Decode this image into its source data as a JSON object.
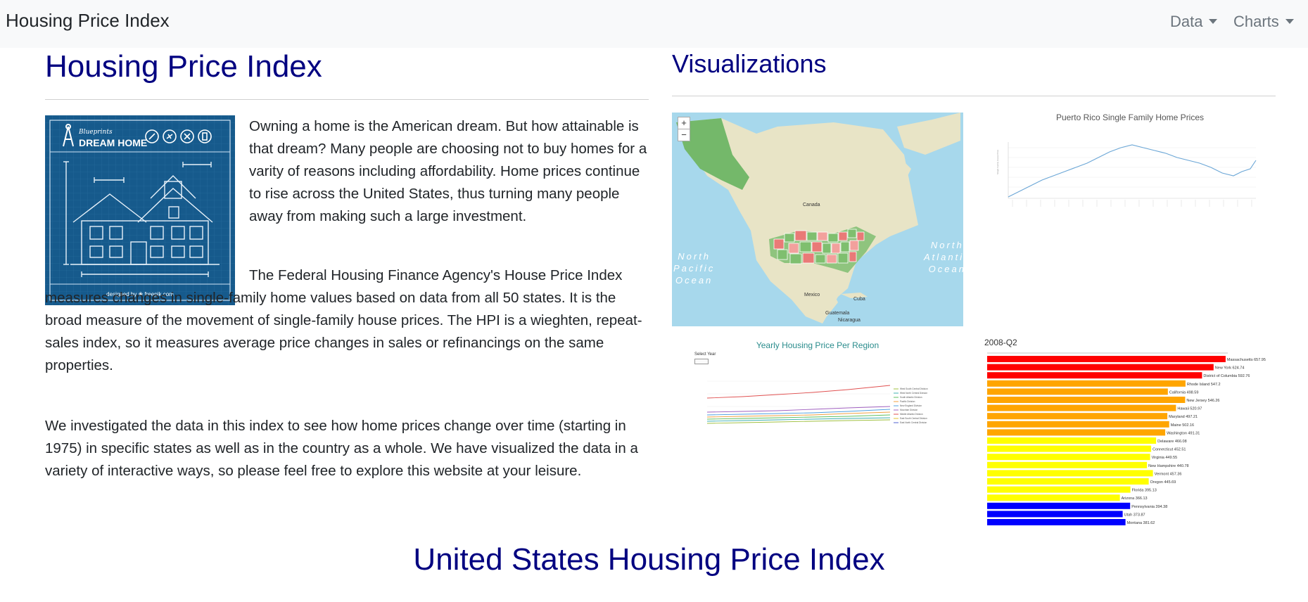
{
  "nav": {
    "brand": "Housing Price Index",
    "items": [
      {
        "label": "Data"
      },
      {
        "label": "Charts"
      }
    ]
  },
  "intro": {
    "title": "Housing Price Index",
    "image": {
      "logo_top": "Blueprints",
      "logo_text": "DREAM HOME",
      "credit": "designed by ❀ freepik.com"
    },
    "paragraphs": [
      "Owning a home is the American dream. But how attainable is that dream? Many people are choosing not to buy homes for a varity of reasons including affordability. Home prices continue to rise across the United States, thus turning many people away from making such a large investment.",
      "The Federal Housing Finance Agency's House Price Index measures changes in single-family home values based on data from all 50 states. It is the broad measure of the movement of single-family house prices. The HPI is a wieghten, repeat-sales index, so it measures average price changes in sales or refinancings on the same properties.",
      "We investigated the data in this index to see how home prices change over time (starting in 1975) in specific states as well as in the country as a whole. We have visualized the data in a variety of interactive ways, so please feel free to explore this website at your leisure."
    ]
  },
  "visualizations": {
    "title": "Visualizations",
    "map": {
      "zoom_in": "+",
      "zoom_out": "−",
      "labels": {
        "canada": "Canada",
        "mexico": "Mexico",
        "cuba": "Cuba",
        "guatemala": "Guatemala",
        "nicaragua": "Nicaragua"
      },
      "oceans": {
        "pacific": "North\nPacific\nOcean",
        "atlantic": "North\nAtlantic\nOcean"
      }
    },
    "line_chart_title": "Puerto Rico Single Family Home Prices",
    "region_chart_title": "Yearly Housing Price Per Region",
    "region_select_label": "Select Year",
    "region_legend": [
      "West South Central Division",
      "West North Central Division",
      "South Atlantic Division",
      "Pacific Division",
      "New England Division",
      "Mountain Division",
      "Middle Atlantic Division",
      "East South Central Division",
      "East North Central Division"
    ],
    "bar_chart_year": "2008-Q2",
    "bar_chart": [
      {
        "label": "Massachusetts 657.95",
        "value": 657.95,
        "color": "#ff0000"
      },
      {
        "label": "New York 624.74",
        "value": 624.74,
        "color": "#ff0000"
      },
      {
        "label": "District of Columbia 592.76",
        "value": 592.76,
        "color": "#ff0000"
      },
      {
        "label": "Rhode Island 547.2",
        "value": 547.2,
        "color": "#ffa500"
      },
      {
        "label": "California 498.59",
        "value": 498.59,
        "color": "#ffa500"
      },
      {
        "label": "New Jersey 546.26",
        "value": 546.26,
        "color": "#ffa500"
      },
      {
        "label": "Hawaii 520.97",
        "value": 520.97,
        "color": "#ffa500"
      },
      {
        "label": "Maryland 497.21",
        "value": 497.21,
        "color": "#ffa500"
      },
      {
        "label": "Maine 502.16",
        "value": 502.16,
        "color": "#ffa500"
      },
      {
        "label": "Washington 491.31",
        "value": 491.31,
        "color": "#ffa500"
      },
      {
        "label": "Delaware 466.08",
        "value": 466.08,
        "color": "#ffff00"
      },
      {
        "label": "Connecticut 452.51",
        "value": 452.51,
        "color": "#ffff00"
      },
      {
        "label": "Virginia 449.55",
        "value": 449.55,
        "color": "#ffff00"
      },
      {
        "label": "New Hampshire 440.78",
        "value": 440.78,
        "color": "#ffff00"
      },
      {
        "label": "Vermont 457.36",
        "value": 457.36,
        "color": "#ffff00"
      },
      {
        "label": "Oregon 445.69",
        "value": 445.69,
        "color": "#ffff00"
      },
      {
        "label": "Florida 395.13",
        "value": 395.13,
        "color": "#ffff00"
      },
      {
        "label": "Arizona 366.13",
        "value": 366.13,
        "color": "#ffff00"
      },
      {
        "label": "Pennsylvania 394.38",
        "value": 394.38,
        "color": "#0000ff"
      },
      {
        "label": "Utah 373.87",
        "value": 373.87,
        "color": "#0000ff"
      },
      {
        "label": "Montana 381.62",
        "value": 381.62,
        "color": "#0000ff"
      }
    ]
  },
  "footer_title": "United States Housing Price Index",
  "colors": {
    "heading": "#000080",
    "navbar_bg": "#f8f9fa",
    "nav_link": "#6c757d"
  }
}
